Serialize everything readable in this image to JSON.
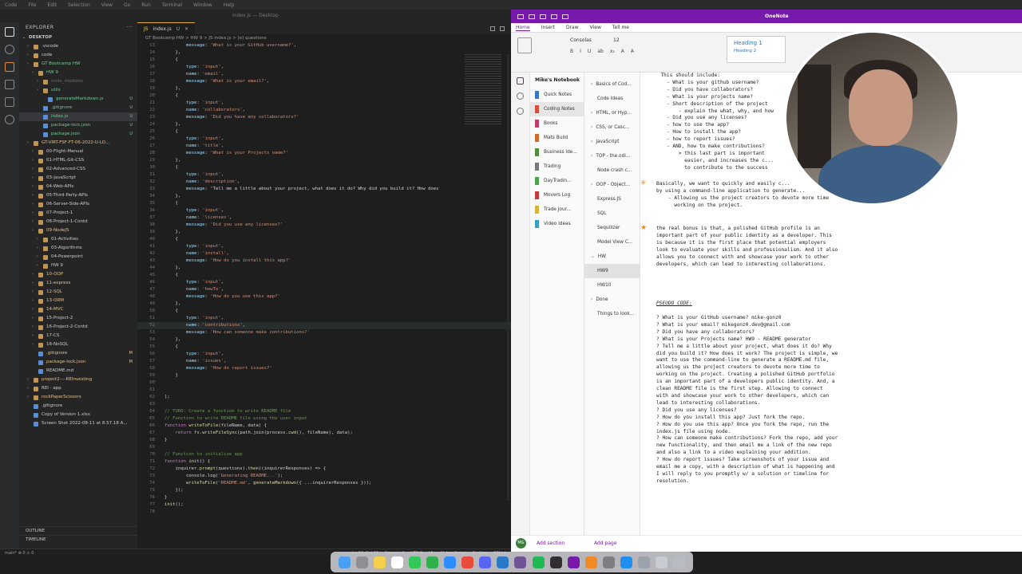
{
  "menubar": [
    "Code",
    "File",
    "Edit",
    "Selection",
    "View",
    "Go",
    "Run",
    "Terminal",
    "Window",
    "Help"
  ],
  "vscode": {
    "title": "index.js — Desktop",
    "explorer_label": "EXPLORER",
    "root_label": "DESKTOP",
    "tree": [
      {
        "label": ".vscode",
        "depth": 1,
        "kind": "folder",
        "color": "#cccccc"
      },
      {
        "label": "code",
        "depth": 1,
        "kind": "folder",
        "color": "#cccccc"
      },
      {
        "label": "GT Bootcamp HW",
        "depth": 1,
        "kind": "folder",
        "color": "#73c991",
        "badge": ""
      },
      {
        "label": "HW 9",
        "depth": 2,
        "kind": "folder",
        "color": "#73c991"
      },
      {
        "label": "node_modules",
        "depth": 3,
        "kind": "folder",
        "color": "#6b6b6b"
      },
      {
        "label": "utils",
        "depth": 3,
        "kind": "folder",
        "color": "#73c991"
      },
      {
        "label": "generateMarkdown.js",
        "depth": 4,
        "kind": "file",
        "color": "#73c991",
        "badge": "U"
      },
      {
        "label": ".gitignore",
        "depth": 3,
        "kind": "file",
        "color": "#73c991",
        "badge": "U"
      },
      {
        "label": "index.js",
        "depth": 3,
        "kind": "file",
        "color": "#73c991",
        "badge": "U",
        "active": true
      },
      {
        "label": "package-lock.json",
        "depth": 3,
        "kind": "file",
        "color": "#73c991",
        "badge": "U"
      },
      {
        "label": "package.json",
        "depth": 3,
        "kind": "file",
        "color": "#73c991",
        "badge": "U"
      },
      {
        "label": "GT-VIRT-FSF-FT-06-2022-U-LO...",
        "depth": 1,
        "kind": "folder",
        "color": "#e2c08d",
        "badge": ""
      },
      {
        "label": "00-Flight-Manual",
        "depth": 2,
        "kind": "folder",
        "color": "#cccccc"
      },
      {
        "label": "01-HTML-Git-CSS",
        "depth": 2,
        "kind": "folder",
        "color": "#cccccc"
      },
      {
        "label": "02-Advanced-CSS",
        "depth": 2,
        "kind": "folder",
        "color": "#cccccc"
      },
      {
        "label": "03-JavaScript",
        "depth": 2,
        "kind": "folder",
        "color": "#cccccc"
      },
      {
        "label": "04-Web-APIs",
        "depth": 2,
        "kind": "folder",
        "color": "#cccccc"
      },
      {
        "label": "05-Third-Party-APIs",
        "depth": 2,
        "kind": "folder",
        "color": "#cccccc"
      },
      {
        "label": "06-Server-Side-APIs",
        "depth": 2,
        "kind": "folder",
        "color": "#cccccc"
      },
      {
        "label": "07-Project-1",
        "depth": 2,
        "kind": "folder",
        "color": "#cccccc"
      },
      {
        "label": "08-Project-1-Contd",
        "depth": 2,
        "kind": "folder",
        "color": "#cccccc"
      },
      {
        "label": "09-NodeJS",
        "depth": 2,
        "kind": "folder",
        "color": "#e2c08d"
      },
      {
        "label": "01-Activities",
        "depth": 3,
        "kind": "folder",
        "color": "#cccccc"
      },
      {
        "label": "03-Algorithms",
        "depth": 3,
        "kind": "folder",
        "color": "#cccccc"
      },
      {
        "label": "04-Powerpoint",
        "depth": 3,
        "kind": "folder",
        "color": "#cccccc"
      },
      {
        "label": "HW 9",
        "depth": 3,
        "kind": "folder",
        "color": "#cccccc"
      },
      {
        "label": "10-OOP",
        "depth": 2,
        "kind": "folder",
        "color": "#e2c08d"
      },
      {
        "label": "11-express",
        "depth": 2,
        "kind": "folder",
        "color": "#e2c08d"
      },
      {
        "label": "12-SQL",
        "depth": 2,
        "kind": "folder",
        "color": "#e2c08d"
      },
      {
        "label": "13-ORM",
        "depth": 2,
        "kind": "folder",
        "color": "#e2c08d"
      },
      {
        "label": "14-MVC",
        "depth": 2,
        "kind": "folder",
        "color": "#e2c08d"
      },
      {
        "label": "15-Project-2",
        "depth": 2,
        "kind": "folder",
        "color": "#cccccc"
      },
      {
        "label": "16-Project-2-Contd",
        "depth": 2,
        "kind": "folder",
        "color": "#cccccc"
      },
      {
        "label": "17-CS",
        "depth": 2,
        "kind": "folder",
        "color": "#cccccc"
      },
      {
        "label": "18-NoSQL",
        "depth": 2,
        "kind": "folder",
        "color": "#cccccc"
      },
      {
        "label": ".gitignore",
        "depth": 2,
        "kind": "file",
        "color": "#e2c08d",
        "badge": "M"
      },
      {
        "label": "package-lock.json",
        "depth": 2,
        "kind": "file",
        "color": "#e2c08d",
        "badge": "M"
      },
      {
        "label": "README.md",
        "depth": 2,
        "kind": "file",
        "color": "#cccccc"
      },
      {
        "label": "project2----REInvesting",
        "depth": 1,
        "kind": "folder",
        "color": "#e2c08d"
      },
      {
        "label": "REI - app",
        "depth": 1,
        "kind": "folder",
        "color": "#cccccc"
      },
      {
        "label": "rockPaperScissors",
        "depth": 1,
        "kind": "folder",
        "color": "#e2c08d"
      },
      {
        "label": ".gitignore",
        "depth": 1,
        "kind": "file",
        "color": "#cccccc"
      },
      {
        "label": "Copy of Version 1.xlsx",
        "depth": 1,
        "kind": "file",
        "color": "#cccccc"
      },
      {
        "label": "Screen Shot 2022-08-11 at 8.57.18 A...",
        "depth": 1,
        "kind": "file",
        "color": "#cccccc"
      }
    ],
    "outline_label": "OUTLINE",
    "timeline_label": "TIMELINE",
    "tab_label": "index.js",
    "tab_badge": "U",
    "breadcrumb": "GT Bootcamp HW  >  HW 9  >  JS index.js  >  [e] questions",
    "status_left": "main*   ⊗ 0 ⚠ 0",
    "status_right": [
      "Ln 52, Col 31",
      "Spaces: 4",
      "UTF-8",
      "LF",
      "{} JavaScript",
      "Go Live",
      "ESLint"
    ],
    "code_lines": [
      {
        "n": 13,
        "t": "        message: 'What is your GitHub username?',"
      },
      {
        "n": 14,
        "t": "    },"
      },
      {
        "n": 15,
        "t": "    {"
      },
      {
        "n": 16,
        "t": "        type: 'input',"
      },
      {
        "n": 17,
        "t": "        name: 'email',"
      },
      {
        "n": 18,
        "t": "        message: 'What is your email?',"
      },
      {
        "n": 19,
        "t": "    },"
      },
      {
        "n": 20,
        "t": "    {"
      },
      {
        "n": 21,
        "t": "        type: 'input',"
      },
      {
        "n": 22,
        "t": "        name: 'collaborators',"
      },
      {
        "n": 23,
        "t": "        message: 'Did you have any collaborators?'"
      },
      {
        "n": 24,
        "t": "    },"
      },
      {
        "n": 25,
        "t": "    {"
      },
      {
        "n": 26,
        "t": "        type: 'input',"
      },
      {
        "n": 27,
        "t": "        name: 'title',"
      },
      {
        "n": 28,
        "t": "        message: 'What is your Projects name?'"
      },
      {
        "n": 29,
        "t": "    },"
      },
      {
        "n": 30,
        "t": "    {"
      },
      {
        "n": 31,
        "t": "        type: 'input',"
      },
      {
        "n": 32,
        "t": "        name: 'description',"
      },
      {
        "n": 33,
        "t": "        message: 'Tell me a little about your project, what does it do? Why did you build it? How does"
      },
      {
        "n": 34,
        "t": "    },"
      },
      {
        "n": 35,
        "t": "    {"
      },
      {
        "n": 36,
        "t": "        type: 'input',"
      },
      {
        "n": 37,
        "t": "        name: 'licenses',"
      },
      {
        "n": 38,
        "t": "        message: 'Did you use any licenses?'"
      },
      {
        "n": 39,
        "t": "    },"
      },
      {
        "n": 40,
        "t": "    {"
      },
      {
        "n": 41,
        "t": "        type: 'input',"
      },
      {
        "n": 42,
        "t": "        name: 'install',"
      },
      {
        "n": 43,
        "t": "        message: 'How do you install this app?'"
      },
      {
        "n": 44,
        "t": "    },"
      },
      {
        "n": 45,
        "t": "    {"
      },
      {
        "n": 46,
        "t": "        type: 'input',"
      },
      {
        "n": 47,
        "t": "        name: 'howTo',"
      },
      {
        "n": 48,
        "t": "        message: 'How do you use this app?'"
      },
      {
        "n": 49,
        "t": "    },"
      },
      {
        "n": 50,
        "t": "    {"
      },
      {
        "n": 51,
        "t": "        type: 'input',"
      },
      {
        "n": 52,
        "t": "        name: 'contributions',",
        "cur": true
      },
      {
        "n": 53,
        "t": "        message: 'How can someone make contributions?'"
      },
      {
        "n": 54,
        "t": "    },"
      },
      {
        "n": 55,
        "t": "    {"
      },
      {
        "n": 56,
        "t": "        type: 'input',"
      },
      {
        "n": 57,
        "t": "        name: 'issues',"
      },
      {
        "n": 58,
        "t": "        message: 'How do report issues?'"
      },
      {
        "n": 59,
        "t": "    }"
      },
      {
        "n": 60,
        "t": ""
      },
      {
        "n": 61,
        "t": ""
      },
      {
        "n": 62,
        "t": "];"
      },
      {
        "n": 63,
        "t": ""
      },
      {
        "n": 64,
        "t": "// TODO: Create a function to write README file"
      },
      {
        "n": 65,
        "t": "// Function to write README file using the user input"
      },
      {
        "n": 66,
        "t": "function writeToFile(fileName, data) {"
      },
      {
        "n": 67,
        "t": "    return fs.writeFileSync(path.join(process.cwd(), fileName), data);"
      },
      {
        "n": 68,
        "t": "}"
      },
      {
        "n": 69,
        "t": ""
      },
      {
        "n": 70,
        "t": "// Function to initialize app"
      },
      {
        "n": 71,
        "t": "function init() {"
      },
      {
        "n": 72,
        "t": "    inquirer.prompt(questions).then((inquirerResponses) => {"
      },
      {
        "n": 73,
        "t": "        console.log('Generating README...');"
      },
      {
        "n": 74,
        "t": "        writeToFile('README.md', generateMarkdown({ ...inquirerResponses }));"
      },
      {
        "n": 75,
        "t": "    });"
      },
      {
        "n": 76,
        "t": "}"
      },
      {
        "n": 77,
        "t": "init();"
      },
      {
        "n": 78,
        "t": ""
      }
    ]
  },
  "onenote": {
    "app_title": "OneNote",
    "ribbon_tabs": [
      "Home",
      "Insert",
      "Draw",
      "View",
      "Tell me"
    ],
    "font_name": "Consolas",
    "font_size": "12",
    "styles": [
      "Heading 1",
      "Heading 2"
    ],
    "format_buttons": [
      "B",
      "I",
      "U",
      "ab",
      "x₂",
      "A",
      "A"
    ],
    "notebook_title": "Mike's Notebook",
    "sections": [
      {
        "label": "Quick Notes",
        "color": "#3b78c4"
      },
      {
        "label": "Coding Notes",
        "color": "#d64f3b",
        "selected": true
      },
      {
        "label": "Books",
        "color": "#c43b6b"
      },
      {
        "label": "Mats Build",
        "color": "#d06a2a"
      },
      {
        "label": "Business Ide...",
        "color": "#4f8f3b"
      },
      {
        "label": "Trading",
        "color": "#7a7a7a"
      },
      {
        "label": "DayTradin...",
        "color": "#4fa34f"
      },
      {
        "label": "Movers Log",
        "color": "#c43b3b"
      },
      {
        "label": "Trade Jour...",
        "color": "#d6b23b"
      },
      {
        "label": "Video Ideas",
        "color": "#3b9ec4"
      }
    ],
    "pages": [
      {
        "label": "Basics of Cod...",
        "chev": "›"
      },
      {
        "label": "Code Ideas",
        "chev": ""
      },
      {
        "label": "HTML, or Hyp...",
        "chev": "›"
      },
      {
        "label": "CSS, or Casc...",
        "chev": "›"
      },
      {
        "label": "JavaScript",
        "chev": "›"
      },
      {
        "label": "TOP - the.odi...",
        "chev": "›"
      },
      {
        "label": "Node crash c...",
        "chev": ""
      },
      {
        "label": "OOP - Object...",
        "chev": "›"
      },
      {
        "label": "Express.JS",
        "chev": ""
      },
      {
        "label": "SQL",
        "chev": ""
      },
      {
        "label": "Sequilizer",
        "chev": ""
      },
      {
        "label": "Model View C...",
        "chev": ""
      },
      {
        "label": "HW",
        "chev": "⌄"
      },
      {
        "label": "HW9",
        "chev": "",
        "selected": true
      },
      {
        "label": "HW10",
        "chev": ""
      },
      {
        "label": "Done",
        "chev": "›"
      },
      {
        "label": "Things to look...",
        "chev": ""
      }
    ],
    "note_top": "  This should include:\n    - What is your github username?\n    - Did you have collaborators?\n    - What is your projects name?\n    - Short description of the project\n        - explain the what, why, and how\n    - Did you use any licenses?\n    - how to use the app?\n    - How to install the app?\n    - how to report issues?\n    - AND, how to make contributions?\n        > this last part is important\n          easier, and increases the c...\n          to contribute to the success",
    "note_mid": "Basically, we want to quickly and easily c...\nby using a command-line application to generate...\n    - Allowing us the project creators to devote more time\n      working on the project.",
    "note_bonus": "the real bonus is that, a polished GitHub profile is an\nimportant part of your public identity as a developer. This\nis because it is the first place that potential employers\nlook to evaluate your skills and professionalism. And it also\nallows you to connect with and showcase your work to other\ndevelopers, which can lead to interesting collaborations.",
    "pseudo_heading": "PSEUDO CODE:",
    "pseudo_body": "? What is your GitHub username? mike-gonz0\n? What is your email? mikegonz0.dev@gmail.com\n? Did you have any collaborators?\n? What is your Projects name? HW9 - README generator\n? Tell me a little about your project, what does it do? Why\ndid you build it? How does it work? The project is simple, we\nwant to use the command-line to generate a README.md file,\nallowing us the project creators to devote more time to\nworking on the project. Creating a polished GitHub portfolio\nis an important part of a developers public identity. And, a\nclean README file is the first step. Allowing to connect\nwith and showcase your work to other developers, which can\nlead to interesting collaborations.\n? Did you use any licenses?\n? How do you install this app? Just fork the repo.\n? How do you use this app? Once you fork the repo, run the\nindex.js file using node.\n? How can someone make contributions? Fork the repo, add your\nnew functionality, and then email me a link of the new repo\nand also a link to a video explaining your addition.\n? How do report issues? Take screenshots of your issue and\nemail me a copy, with a description of what is happening and\nI will reply to you promptly w/ a solution or timeline for\nresolution.",
    "user_initials": "MG",
    "add_section": "Add section",
    "add_page": "Add page"
  },
  "dock_icons": [
    {
      "name": "finder-icon",
      "color": "#4a9ff5"
    },
    {
      "name": "launchpad-icon",
      "color": "#8e8e93"
    },
    {
      "name": "notes-icon",
      "color": "#f5d04a"
    },
    {
      "name": "calendar-icon",
      "color": "#ffffff"
    },
    {
      "name": "messages-icon",
      "color": "#34c759"
    },
    {
      "name": "facetime-icon",
      "color": "#30b04a"
    },
    {
      "name": "zoom-icon",
      "color": "#2d8cff"
    },
    {
      "name": "chrome-icon",
      "color": "#e84a3b"
    },
    {
      "name": "discord-icon",
      "color": "#5865f2"
    },
    {
      "name": "vscode-icon",
      "color": "#2979c8"
    },
    {
      "name": "github-desktop-icon",
      "color": "#6e5494"
    },
    {
      "name": "spotify-icon",
      "color": "#1db954"
    },
    {
      "name": "obs-icon",
      "color": "#302e31"
    },
    {
      "name": "onenote-icon",
      "color": "#7719aa"
    },
    {
      "name": "books-icon",
      "color": "#f08a24"
    },
    {
      "name": "settings-icon",
      "color": "#7d7d82"
    },
    {
      "name": "appstore-icon",
      "color": "#1f8ef1"
    },
    {
      "name": "preview-icon",
      "color": "#9aa3ad"
    },
    {
      "name": "documents-icon",
      "color": "#c8ccd2"
    },
    {
      "name": "trash-icon",
      "color": "#b8bcc2"
    }
  ]
}
